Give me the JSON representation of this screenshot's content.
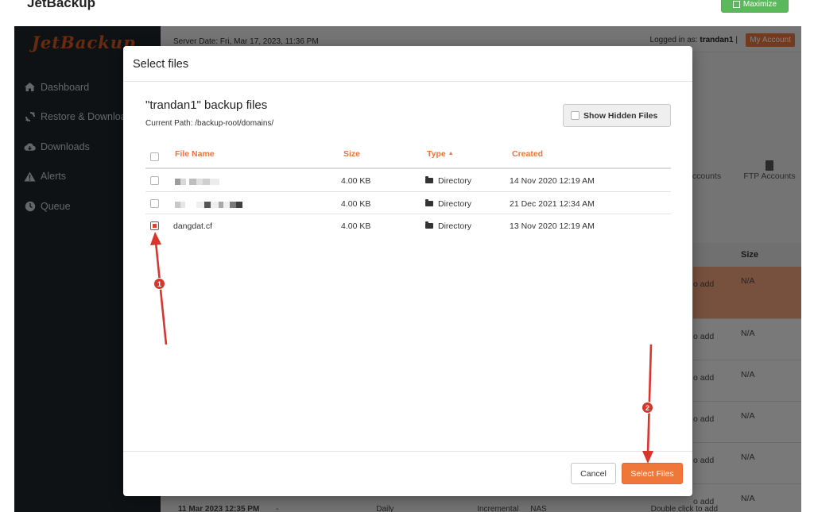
{
  "page": {
    "title": "JetBackup",
    "maximize_label": "Maximize"
  },
  "app": {
    "logo": "JetBackup",
    "server_date": "Server Date: Fri, Mar 17, 2023, 11:36 PM",
    "logged_in_prefix": "Logged in as:",
    "username": "trandan1",
    "separator": "|",
    "my_account": "My Account",
    "nav": [
      {
        "label": "Dashboard",
        "icon": "home-icon"
      },
      {
        "label": "Restore & Downloads",
        "icon": "refresh-icon"
      },
      {
        "label": "Downloads",
        "icon": "cloud-download-icon"
      },
      {
        "label": "Alerts",
        "icon": "warning-icon"
      },
      {
        "label": "Queue",
        "icon": "clock-icon"
      }
    ],
    "bg_tabs": [
      "ccounts",
      "FTP Accounts"
    ],
    "bg_table": {
      "size_header": "Size",
      "add_text": "o add",
      "na": "N/A",
      "bottom_row": {
        "date": "11 Mar 2023 12:35 PM",
        "dash": "-",
        "freq": "Daily",
        "type": "Incremental",
        "dest": "NAS",
        "action": "Double click to add"
      }
    }
  },
  "modal": {
    "title": "Select files",
    "panel_title": "\"trandan1\" backup files",
    "current_path": "Current Path: /backup-root/domains/",
    "show_hidden_label": "Show Hidden Files",
    "columns": {
      "name": "File Name",
      "size": "Size",
      "type": "Type",
      "created": "Created"
    },
    "sort_indicator": "▲",
    "rows": [
      {
        "name": "",
        "name_blurred": true,
        "checked": false,
        "size": "4.00 KB",
        "type": "Directory",
        "created": "14 Nov 2020 12:19 AM"
      },
      {
        "name": "",
        "name_blurred": true,
        "checked": false,
        "size": "4.00 KB",
        "type": "Directory",
        "created": "21 Dec 2021 12:34 AM"
      },
      {
        "name": "dangdat.cf",
        "name_blurred": false,
        "checked": true,
        "size": "4.00 KB",
        "type": "Directory",
        "created": "13 Nov 2020 12:19 AM"
      }
    ],
    "cancel_label": "Cancel",
    "select_label": "Select Files"
  },
  "annotations": [
    {
      "label": "1"
    },
    {
      "label": "2"
    }
  ],
  "colors": {
    "accent": "#f0773a",
    "sidebar": "#1f2429",
    "annotation": "#d8352d",
    "maximize": "#5cb85c"
  }
}
